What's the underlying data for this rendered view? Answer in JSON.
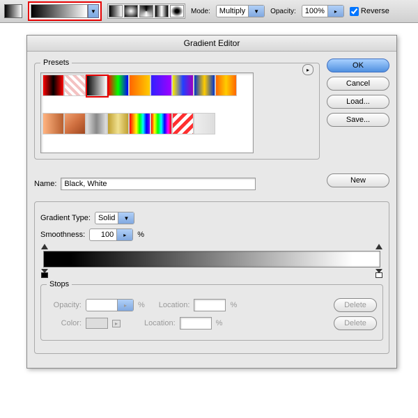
{
  "toolbar": {
    "mode_label": "Mode:",
    "mode_value": "Multiply",
    "opacity_label": "Opacity:",
    "opacity_value": "100%",
    "reverse_label": "Reverse"
  },
  "dialog": {
    "title": "Gradient Editor",
    "buttons": {
      "ok": "OK",
      "cancel": "Cancel",
      "load": "Load...",
      "save": "Save...",
      "new": "New"
    },
    "presets_label": "Presets",
    "name_label": "Name:",
    "name_value": "Black, White",
    "type_label": "Gradient Type:",
    "type_value": "Solid",
    "smooth_label": "Smoothness:",
    "smooth_value": "100",
    "pct": "%",
    "stops": {
      "legend": "Stops",
      "opacity_label": "Opacity:",
      "location_label": "Location:",
      "color_label": "Color:",
      "delete": "Delete"
    },
    "presets": [
      "linear-gradient(90deg,#ff0000,#000,#ff0000)",
      "repeating-linear-gradient(45deg,#fff 0 4px,#f4c2c2 4px 8px)",
      "linear-gradient(90deg,#000,#fff)",
      "linear-gradient(90deg,#ff0000,#00ff00,#0000ff)",
      "linear-gradient(90deg,#ff6600,#ffcc00)",
      "linear-gradient(90deg,#3020ff,#a000ff)",
      "linear-gradient(90deg,#ffea00,#2040ff,#a000c0)",
      "linear-gradient(90deg,#0033cc,#ffcc00,#0033cc)",
      "linear-gradient(90deg,#ff6600,#ffcc00,#ff6600)",
      "linear-gradient(90deg,#ffb380,#b86030)",
      "linear-gradient(135deg,#f0a070,#d07040,#a04820)",
      "linear-gradient(90deg,#e0e0e0,#888,#e0e0e0)",
      "linear-gradient(90deg,#c0a030,#f0e090,#c0a030)",
      "linear-gradient(90deg,#ff0000,#ff8000,#ffff00,#00ff00,#00ffff,#0000ff,#8000ff)",
      "linear-gradient(90deg,#ff0000,#ffff00,#00ff00,#00ffff,#0000ff,#ff00ff,#ff0000)",
      "repeating-linear-gradient(135deg,#ff3030 0 5px,#fff 5px 10px)",
      "linear-gradient(90deg,#eee,#ddd)"
    ]
  }
}
